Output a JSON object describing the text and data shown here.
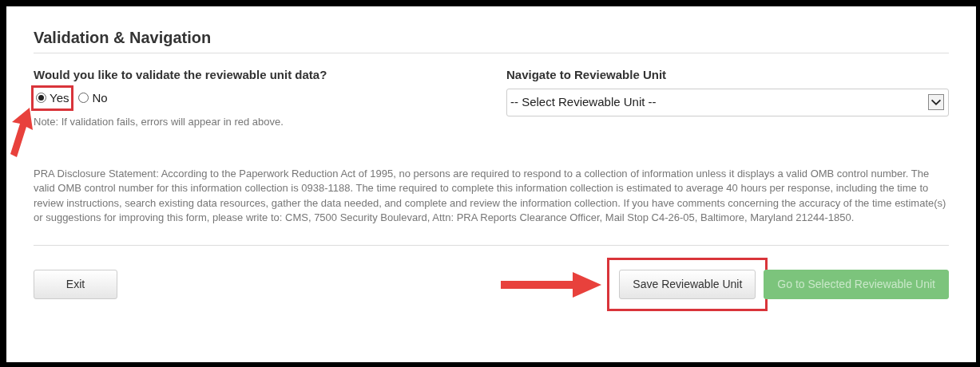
{
  "title": "Validation & Navigation",
  "validate": {
    "question": "Would you like to validate the reviewable unit data?",
    "options": [
      {
        "label": "Yes",
        "selected": true,
        "highlighted": true
      },
      {
        "label": "No",
        "selected": false,
        "highlighted": false
      }
    ],
    "note": "Note: If validation fails, errors will appear in red above."
  },
  "navigate": {
    "label": "Navigate to Reviewable Unit",
    "value": "-- Select Reviewable Unit --"
  },
  "disclosure": "PRA Disclosure Statement: According to the Paperwork Reduction Act of 1995, no persons are required to respond to a collection of information unless it displays a valid OMB control number. The valid OMB control number for this information collection is 0938-1188. The time required to complete this information collection is estimated to average 40 hours per response, including the time to review instructions, search existing data resources, gather the data needed, and complete and review the information collection. If you have comments concerning the accuracy of the time estimate(s) or suggestions for improving this form, please write to: CMS, 7500 Security Boulevard, Attn: PRA Reports Clearance Officer, Mail Stop C4-26-05, Baltimore, Maryland 21244-1850.",
  "buttons": [
    {
      "label": "Exit",
      "kind": "default",
      "disabled": false,
      "highlighted": false
    },
    {
      "label": "Save Reviewable Unit",
      "kind": "default",
      "disabled": false,
      "highlighted": true
    },
    {
      "label": "Go to Selected Reviewable Unit",
      "kind": "success",
      "disabled": true,
      "highlighted": false
    }
  ]
}
